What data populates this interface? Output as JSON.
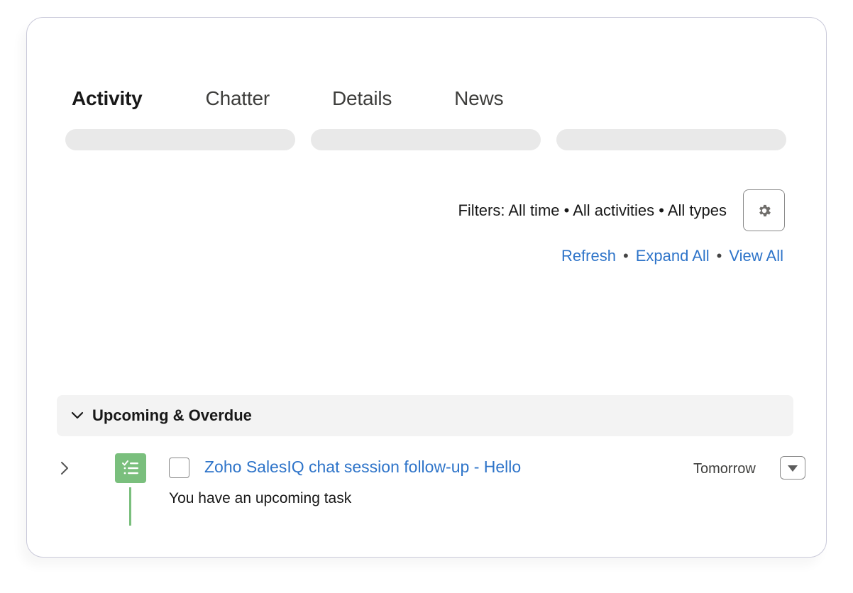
{
  "tabs": [
    {
      "label": "Activity",
      "active": true
    },
    {
      "label": "Chatter",
      "active": false
    },
    {
      "label": "Details",
      "active": false
    },
    {
      "label": "News",
      "active": false
    }
  ],
  "filters": {
    "text": "Filters: All time • All activities • All types",
    "settings_icon": "gear-icon"
  },
  "actions": {
    "refresh": "Refresh",
    "expand_all": "Expand All",
    "view_all": "View All",
    "separator": "•"
  },
  "section": {
    "title": "Upcoming & Overdue",
    "icon": "chevron-down-icon"
  },
  "task": {
    "title": "Zoho SalesIQ chat session follow-up - Hello",
    "subtitle": "You have an upcoming task",
    "date": "Tomorrow",
    "icon": "task-icon",
    "checked": false
  },
  "colors": {
    "link": "#2e74c9",
    "task_green": "#7abf7d",
    "skeleton": "#e9e9e9",
    "section_bg": "#f3f3f3"
  }
}
